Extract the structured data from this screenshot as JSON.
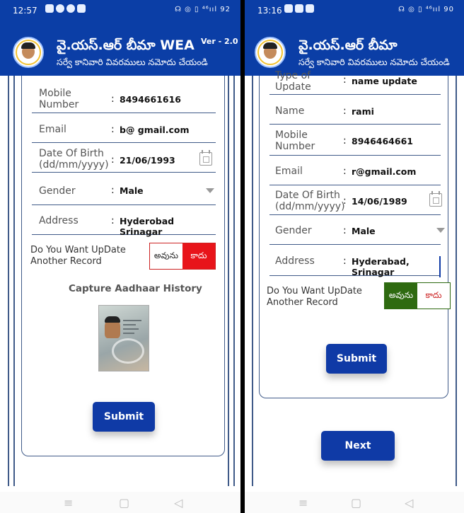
{
  "left": {
    "status_time": "12:57",
    "status_right": "☊ ◎ ▯ ⁴⁶ııl 92",
    "title": "వై.యస్.ఆర్ బీమా WEA",
    "version": "Ver - 2.0",
    "subtitle": "సర్వే కానివారి వివరములు నమోదు చేయండి",
    "fields": {
      "mobile_label": "Mobile Number",
      "mobile_value": "8494661616",
      "email_label": "Email",
      "email_value": "b@ gmail.com",
      "dob_label": "Date Of Birth (dd/mm/yyyy)",
      "dob_value": "21/06/1993",
      "gender_label": "Gender",
      "gender_value": "Male",
      "address_label": "Address",
      "address_value": "Hyderobad Srinagar"
    },
    "question": "Do You Want  UpDate Another Record",
    "yes_label": "అవును",
    "no_label": "కాదు",
    "selected": "no",
    "capture_title": "Capture Aadhaar History",
    "submit_label": "Submit"
  },
  "right": {
    "status_time": "13:16",
    "status_right": "☊ ◎ ▯ ⁴⁶ııl 90",
    "title": "వై.యస్.ఆర్ బీమా",
    "subtitle": "సర్వే కానివారి వివరములు నమోదు చేయండి",
    "fields": {
      "type_label": "Type of Update",
      "type_value": "name update",
      "name_label": "Name",
      "name_value": "rami",
      "mobile_label": "Mobile Number",
      "mobile_value": "8946464661",
      "email_label": "Email",
      "email_value": "r@gmail.com",
      "dob_label": "Date Of Birth (dd/mm/yyyy)",
      "dob_value": "14/06/1989",
      "gender_label": "Gender",
      "gender_value": "Male",
      "address_label": "Address",
      "address_value": "Hyderabad, Srinagar"
    },
    "question": "Do You Want  UpDate Another Record",
    "yes_label": "అవును",
    "no_label": "కాదు",
    "selected": "yes",
    "submit_label": "Submit",
    "next_label": "Next"
  },
  "colors": {
    "appbar": "#0b3ea6",
    "button": "#0f3aa6",
    "no_selected": "#e8141a",
    "yes_selected": "#2e6a10"
  }
}
